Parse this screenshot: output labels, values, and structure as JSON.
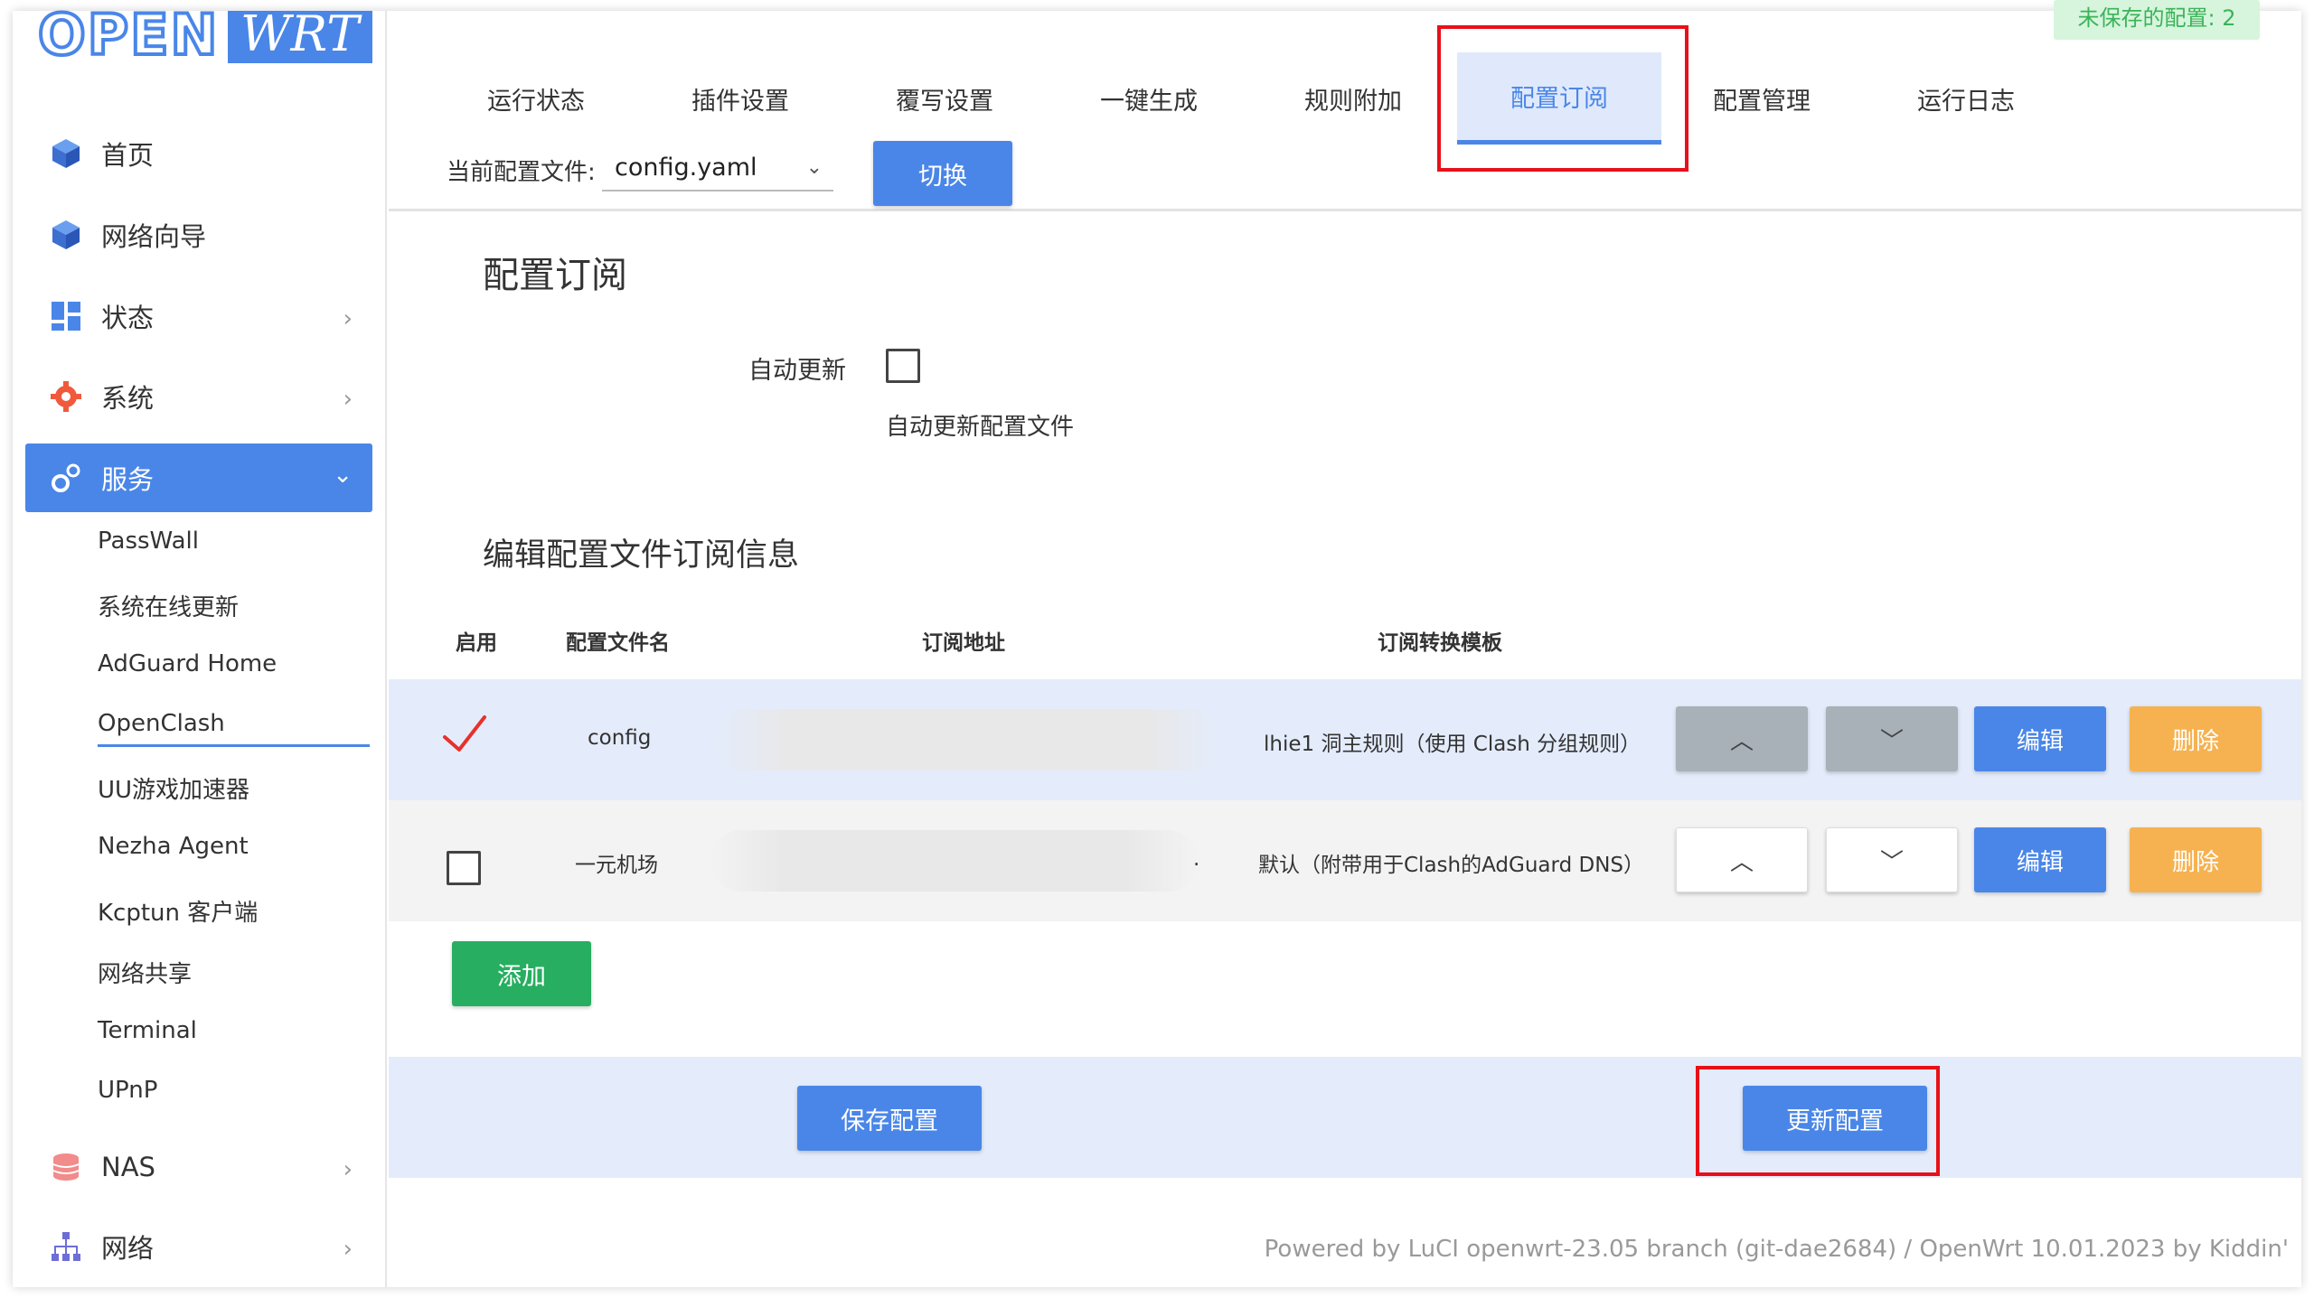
{
  "logo": {
    "part1": "OPEN",
    "part2": "WRT"
  },
  "status": {
    "unsaved": "未保存的配置: 2"
  },
  "sidebar": {
    "items": [
      {
        "label": "首页",
        "icon": "cube-icon"
      },
      {
        "label": "网络向导",
        "icon": "cube-icon"
      },
      {
        "label": "状态",
        "icon": "dashboard-icon"
      },
      {
        "label": "系统",
        "icon": "gear-icon"
      },
      {
        "label": "服务",
        "icon": "gears-icon"
      },
      {
        "label": "NAS",
        "icon": "database-icon"
      },
      {
        "label": "网络",
        "icon": "network-icon"
      }
    ],
    "services": [
      "PassWall",
      "系统在线更新",
      "AdGuard Home",
      "OpenClash",
      "UU游戏加速器",
      "Nezha Agent",
      "Kcptun 客户端",
      "网络共享",
      "Terminal",
      "UPnP"
    ]
  },
  "tabs": [
    "运行状态",
    "插件设置",
    "覆写设置",
    "一键生成",
    "规则附加",
    "配置订阅",
    "配置管理",
    "运行日志"
  ],
  "config": {
    "label": "当前配置文件:",
    "value": "config.yaml",
    "switch": "切换"
  },
  "main": {
    "title": "配置订阅",
    "auto_update_label": "自动更新",
    "auto_update_desc": "自动更新配置文件",
    "edit_title": "编辑配置文件订阅信息"
  },
  "table": {
    "headers": [
      "启用",
      "配置文件名",
      "订阅地址",
      "订阅转换模板"
    ],
    "rows": [
      {
        "enabled": true,
        "name": "config",
        "template": "lhie1 洞主规则（使用 Clash 分组规则）"
      },
      {
        "enabled": false,
        "name": "一元机场",
        "template": "默认（附带用于Clash的AdGuard DNS）"
      }
    ],
    "actions": {
      "up": "︿",
      "down": "﹀",
      "edit": "编辑",
      "delete": "删除"
    },
    "row2_ellipsis": "."
  },
  "buttons": {
    "add": "添加",
    "save": "保存配置",
    "update": "更新配置"
  },
  "footer": {
    "powered": "Powered by LuCI openwrt-23.05 branch (git-dae2684) / OpenWrt 10.01.2023 by Kiddin'"
  },
  "colors": {
    "accent": "#4a86e8",
    "success": "#27ae60",
    "warning": "#f6b250",
    "highlight": "#e8101a"
  }
}
